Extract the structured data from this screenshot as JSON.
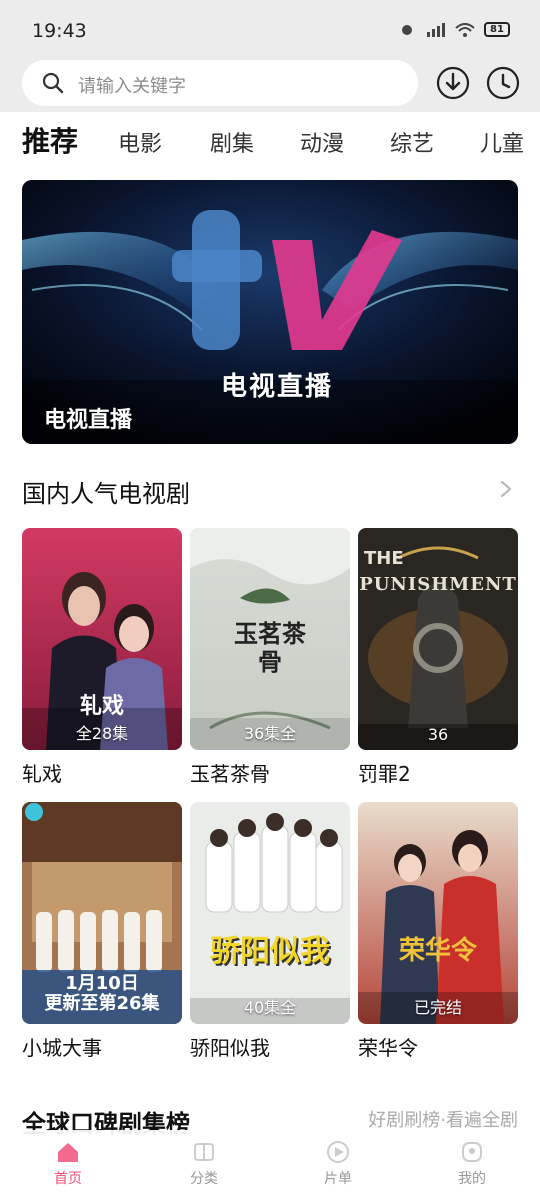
{
  "status_bar": {
    "time": "19:43",
    "battery": "81"
  },
  "search": {
    "placeholder": "请输入关键字"
  },
  "tabs": [
    {
      "label": "推荐",
      "active": true
    },
    {
      "label": "电影",
      "active": false
    },
    {
      "label": "剧集",
      "active": false
    },
    {
      "label": "动漫",
      "active": false
    },
    {
      "label": "综艺",
      "active": false
    },
    {
      "label": "儿童",
      "active": false
    }
  ],
  "banner": {
    "center_text": "电视直播",
    "label": "电视直播"
  },
  "section1": {
    "title": "国内人气电视剧"
  },
  "shows": [
    {
      "title": "轧戏",
      "badge": "全28集"
    },
    {
      "title": "玉茗茶骨",
      "badge": "36集全"
    },
    {
      "title": "罚罪2",
      "badge": "36"
    },
    {
      "title": "小城大事",
      "badge": "1月10日\n更新至第26集"
    },
    {
      "title": "骄阳似我",
      "badge": "40集全"
    },
    {
      "title": "荣华令",
      "badge": "已完结"
    }
  ],
  "poster_text": {
    "show1": "轧戏",
    "show2": "玉茗茶骨",
    "show3_line1": "THE",
    "show3_line2": "PUNISHMENT",
    "show4": "1月10日",
    "show5": "骄阳似我",
    "show6": "荣华令"
  },
  "section2": {
    "title": "全球口碑剧集榜",
    "more": "好剧刷榜·看遍全剧"
  },
  "bottom_nav": [
    {
      "label": "首页",
      "active": true
    },
    {
      "label": "分类",
      "active": false
    },
    {
      "label": "片单",
      "active": false
    },
    {
      "label": "我的",
      "active": false
    }
  ],
  "colors": {
    "accent": "#f0507a",
    "status_bg": "#ececec"
  }
}
